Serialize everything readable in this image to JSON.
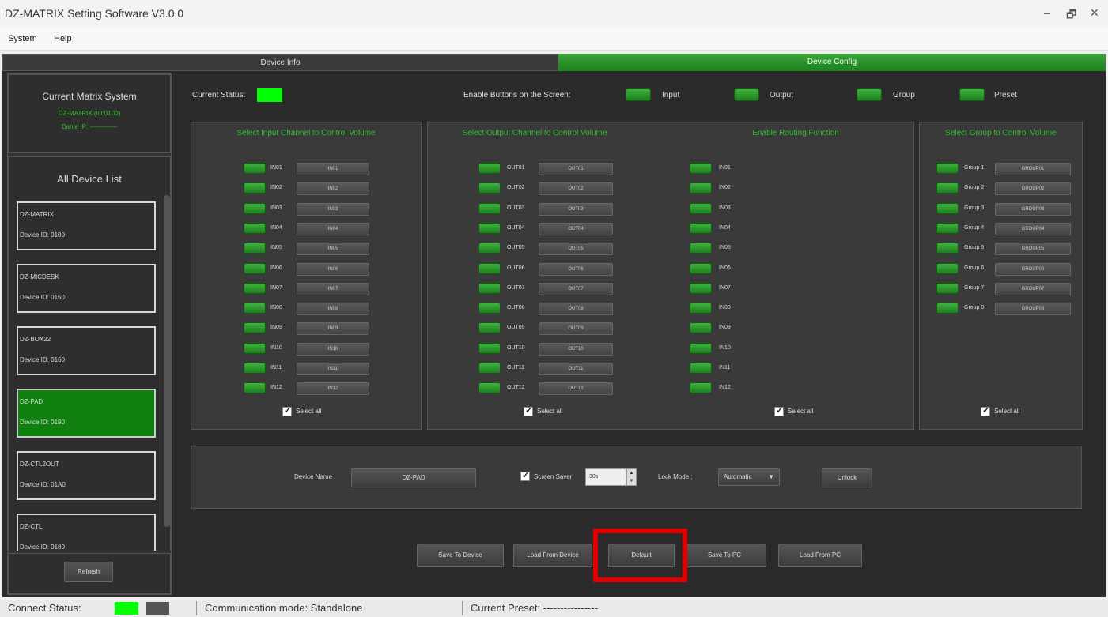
{
  "window": {
    "title": "DZ-MATRIX Setting Software V3.0.0",
    "minimize": "–",
    "restore": "🗗",
    "close": "✕"
  },
  "menu": {
    "system": "System",
    "help": "Help"
  },
  "tabs": {
    "device_info": "Device Info",
    "device_config": "Device Config"
  },
  "sidebar": {
    "system_title": "Current Matrix System",
    "system_name": "DZ-MATRIX (ID:0100)",
    "system_ip": "Dante IP: -------------",
    "list_title": "All Device List",
    "devices": [
      {
        "name": "DZ-MATRIX",
        "id": "Device ID: 0100",
        "selected": false
      },
      {
        "name": "DZ-MICDESK",
        "id": "Device ID: 0150",
        "selected": false
      },
      {
        "name": "DZ-BOX22",
        "id": "Device ID: 0160",
        "selected": false
      },
      {
        "name": "DZ-PAD",
        "id": "Device ID: 0190",
        "selected": true
      },
      {
        "name": "DZ-CTL2OUT",
        "id": "Device ID: 01A0",
        "selected": false
      },
      {
        "name": "DZ-CTL",
        "id": "Device ID: 0180",
        "selected": false
      }
    ],
    "refresh": "Refresh"
  },
  "status_row": {
    "current_status": "Current Status:",
    "enable_buttons": "Enable Buttons on the Screen:",
    "input": "Input",
    "output": "Output",
    "group": "Group",
    "preset": "Preset"
  },
  "panels": {
    "input_title": "Select Input Channel to Control Volume",
    "output_title": "Select Output Channel to Control Volume",
    "routing_title": "Enable Routing Function",
    "group_title": "Select Group to Control Volume",
    "select_all": "Select all",
    "inputs": [
      {
        "label": "IN01",
        "btn": "IN01"
      },
      {
        "label": "IN02",
        "btn": "IN02"
      },
      {
        "label": "IN03",
        "btn": "IN03"
      },
      {
        "label": "IN04",
        "btn": "IN04"
      },
      {
        "label": "IN05",
        "btn": "IN05"
      },
      {
        "label": "IN06",
        "btn": "IN06"
      },
      {
        "label": "IN07",
        "btn": "IN07"
      },
      {
        "label": "IN08",
        "btn": "IN08"
      },
      {
        "label": "IN09",
        "btn": "IN09"
      },
      {
        "label": "IN10",
        "btn": "IN10"
      },
      {
        "label": "IN11",
        "btn": "IN11"
      },
      {
        "label": "IN12",
        "btn": "IN12"
      }
    ],
    "outputs": [
      {
        "label": "OUT01",
        "btn": "OUT01"
      },
      {
        "label": "OUT02",
        "btn": "OUT02"
      },
      {
        "label": "OUT03",
        "btn": "OUT03"
      },
      {
        "label": "OUT04",
        "btn": "OUT04"
      },
      {
        "label": "OUT05",
        "btn": "OUT05"
      },
      {
        "label": "OUT06",
        "btn": "OUT06"
      },
      {
        "label": "OUT07",
        "btn": "OUT07"
      },
      {
        "label": "OUT08",
        "btn": "OUT08"
      },
      {
        "label": "OUT09",
        "btn": "OUT09"
      },
      {
        "label": "OUT10",
        "btn": "OUT10"
      },
      {
        "label": "OUT11",
        "btn": "OUT11"
      },
      {
        "label": "OUT12",
        "btn": "OUT12"
      }
    ],
    "routing": [
      "IN01",
      "IN02",
      "IN03",
      "IN04",
      "IN05",
      "IN06",
      "IN07",
      "IN08",
      "IN09",
      "IN10",
      "IN11",
      "IN12"
    ],
    "groups": [
      {
        "label": "Group 1",
        "btn": "GROUP01"
      },
      {
        "label": "Group 2",
        "btn": "GROUP02"
      },
      {
        "label": "Group 3",
        "btn": "GROUP03"
      },
      {
        "label": "Group 4",
        "btn": "GROUP04"
      },
      {
        "label": "Group 5",
        "btn": "GROUP05"
      },
      {
        "label": "Group 6",
        "btn": "GROUP06"
      },
      {
        "label": "Group 7",
        "btn": "GROUP07"
      },
      {
        "label": "Group 8",
        "btn": "GROUP08"
      }
    ]
  },
  "device_panel": {
    "name_label": "Device Name :",
    "name_value": "DZ-PAD",
    "screen_saver": "Screen Saver",
    "screen_saver_value": "30s",
    "lock_mode_label": "Lock Mode :",
    "lock_mode_value": "Automatic",
    "unlock": "Unlock"
  },
  "actions": {
    "save_device": "Save To Device",
    "load_device": "Load From Device",
    "default": "Default",
    "save_pc": "Save To PC",
    "load_pc": "Load From PC"
  },
  "statusbar": {
    "connect": "Connect Status:",
    "comm": "Communication mode: Standalone",
    "preset": "Current Preset: ----------------"
  },
  "colors": {
    "accent_green": "#1f8f1f",
    "highlight": "#e00000",
    "led_on": "#00ff00"
  }
}
